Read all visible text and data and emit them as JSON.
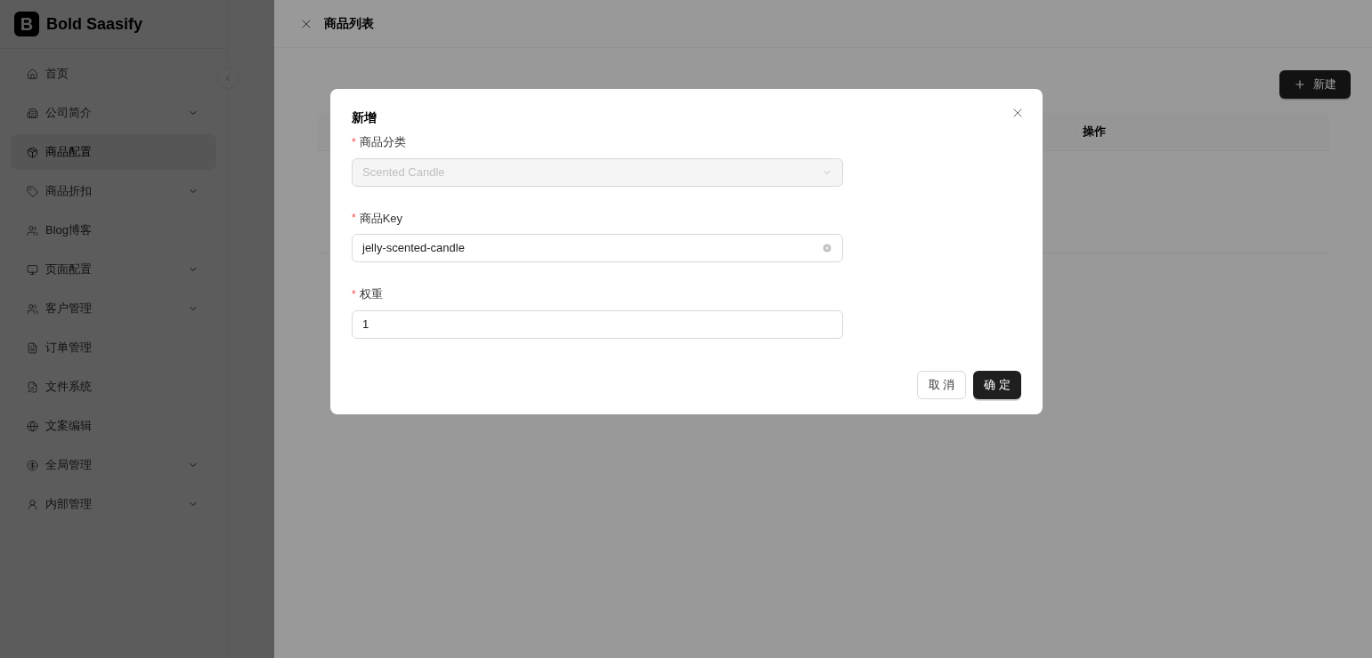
{
  "brand": {
    "logo_letter": "B",
    "name": "Bold Saasify"
  },
  "sidebar": {
    "items": [
      {
        "label": "首页",
        "kind": "link",
        "selected": false
      },
      {
        "label": "公司简介",
        "kind": "group",
        "selected": false
      },
      {
        "label": "商品配置",
        "kind": "link",
        "selected": true
      },
      {
        "label": "商品折扣",
        "kind": "group",
        "selected": false
      },
      {
        "label": "Blog博客",
        "kind": "link",
        "selected": false
      },
      {
        "label": "页面配置",
        "kind": "group",
        "selected": false
      },
      {
        "label": "客户管理",
        "kind": "group",
        "selected": false
      },
      {
        "label": "订单管理",
        "kind": "link",
        "selected": false
      },
      {
        "label": "文件系统",
        "kind": "link",
        "selected": false
      },
      {
        "label": "文案编辑",
        "kind": "link",
        "selected": false
      },
      {
        "label": "全局管理",
        "kind": "group",
        "selected": false
      },
      {
        "label": "内部管理",
        "kind": "group",
        "selected": false
      }
    ]
  },
  "drawer": {
    "title": "商品列表",
    "new_button": "新建",
    "table": {
      "columns": [
        "操作"
      ]
    }
  },
  "modal": {
    "title": "新增",
    "fields": [
      {
        "label": "商品分类",
        "required_mark": "*",
        "kind": "select",
        "value": "Scented Candle",
        "disabled": true
      },
      {
        "label": "商品Key",
        "required_mark": "*",
        "kind": "input",
        "value": "jelly-scented-candle",
        "clearable": true
      },
      {
        "label": "权重",
        "required_mark": "*",
        "kind": "input",
        "value": "1",
        "clearable": false
      }
    ],
    "buttons": [
      {
        "label": "取 消",
        "kind": "default"
      },
      {
        "label": "确 定",
        "kind": "primary"
      }
    ]
  }
}
